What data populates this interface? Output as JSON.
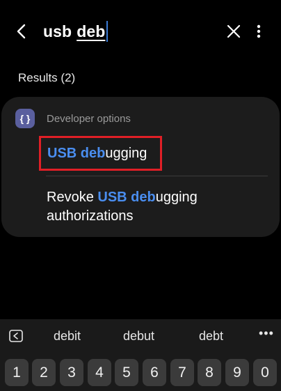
{
  "search": {
    "query_plain": "usb",
    "query_underlined": "deb"
  },
  "results": {
    "label": "Results (2)",
    "category": "Developer options",
    "category_icon": "braces-icon",
    "category_icon_glyph": "{ }",
    "items": [
      {
        "highlight": "USB deb",
        "rest": "ugging"
      },
      {
        "prefix": "Revoke ",
        "highlight": "USB deb",
        "rest": "ugging",
        "line2": "authorizations"
      }
    ]
  },
  "keyboard": {
    "suggestions": [
      "debit",
      "debut",
      "debt"
    ],
    "more_glyph": "•••",
    "number_keys": [
      "1",
      "2",
      "3",
      "4",
      "5",
      "6",
      "7",
      "8",
      "9",
      "0"
    ]
  },
  "colors": {
    "highlight": "#4a8ef0",
    "selection_box": "#e01f26",
    "card_bg": "#1c1c1c",
    "category_icon_bg": "#5a5f9e"
  }
}
